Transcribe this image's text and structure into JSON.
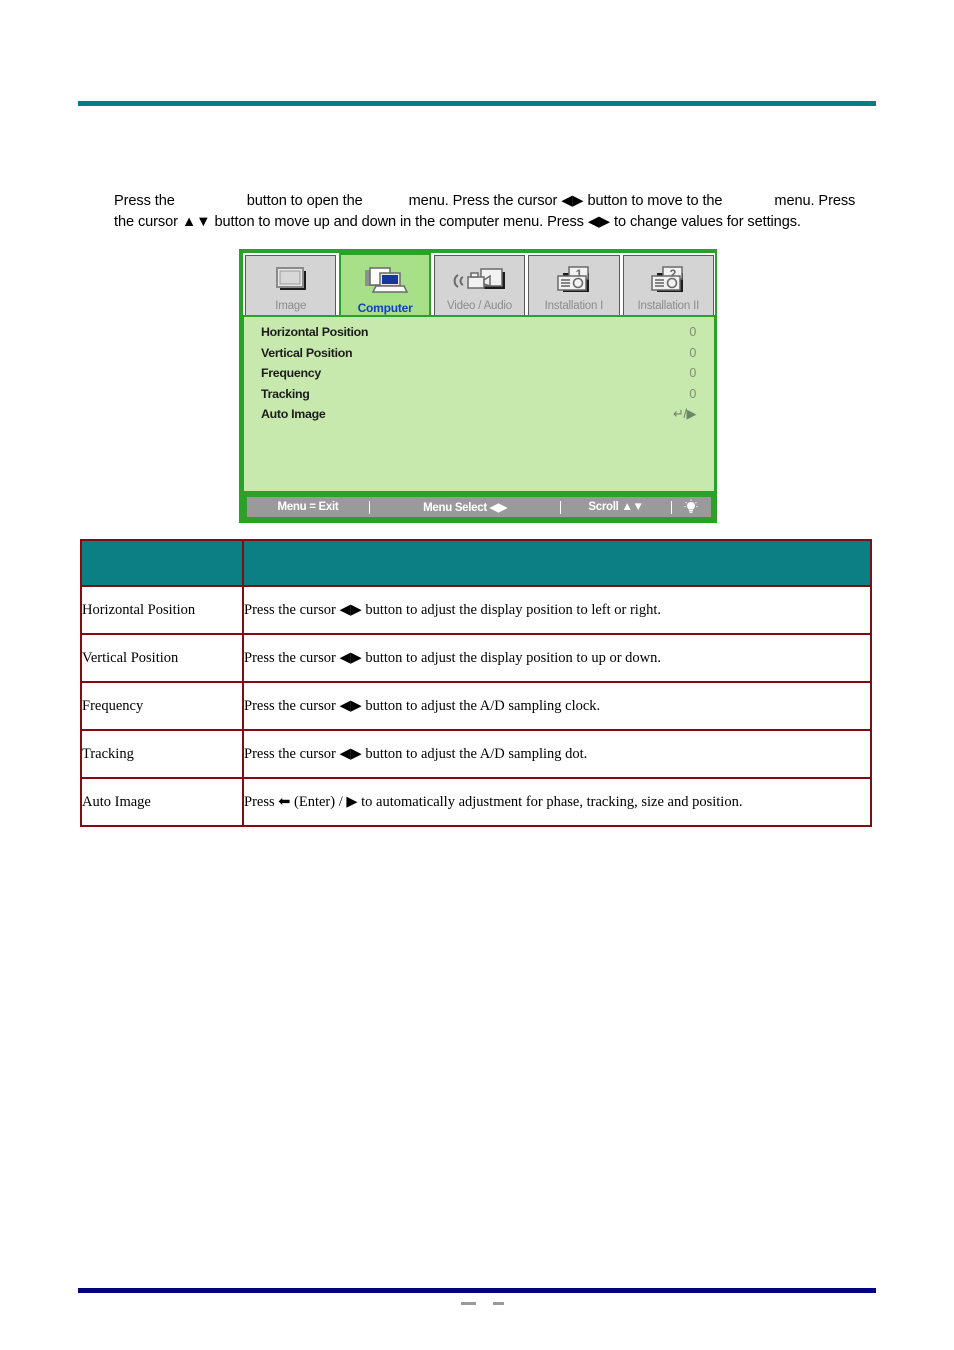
{
  "intro": {
    "seg1": "Press the",
    "seg2": "button to open the",
    "seg3": "menu. Press the cursor ◀▶ button to move to the",
    "seg4": "menu. Press the cursor ▲▼ button to move up and down in the computer menu. Press ◀▶ to change values for settings."
  },
  "osd": {
    "tabs": [
      {
        "label": "Image",
        "icon": "screen-icon",
        "active": false
      },
      {
        "label": "Computer",
        "icon": "laptop-icon",
        "active": true
      },
      {
        "label": "Video / Audio",
        "icon": "camcorder-icon",
        "active": false
      },
      {
        "label": "Installation I",
        "icon": "projector-one-icon",
        "active": false
      },
      {
        "label": "Installation II",
        "icon": "projector-two-icon",
        "active": false
      }
    ],
    "items": [
      {
        "label": "Horizontal Position",
        "value": "0"
      },
      {
        "label": "Vertical Position",
        "value": "0"
      },
      {
        "label": "Frequency",
        "value": "0"
      },
      {
        "label": "Tracking",
        "value": "0"
      },
      {
        "label": "Auto Image",
        "value": "↵/▶"
      }
    ],
    "footer": {
      "exit": "Menu = Exit",
      "select": "Menu Select ◀▶",
      "scroll": "Scroll ▲▼",
      "lamp": "lamp-icon"
    },
    "colors": {
      "border": "#2aa22a",
      "body_bg": "#c8e9ae",
      "active_tab_bg": "#a8e08a",
      "active_tab_text": "#1040c0",
      "tab_bg": "#d4d4d4",
      "tab_text": "#8c8c8c",
      "footer_bg": "#9a9a9a"
    }
  },
  "table": {
    "header": {
      "col_a": "",
      "col_b": ""
    },
    "rows": [
      {
        "item": "Horizontal Position",
        "desc": "Press the cursor ◀▶ button to adjust the display position to left or right."
      },
      {
        "item": "Vertical Position",
        "desc": "Press the cursor ◀▶ button to adjust the display position to up or down."
      },
      {
        "item": "Frequency",
        "desc": "Press the cursor ◀▶ button to adjust the A/D sampling clock."
      },
      {
        "item": "Tracking",
        "desc": "Press the cursor ◀▶ button to adjust the A/D sampling dot."
      },
      {
        "item": "Auto Image",
        "desc": "Press ⬅ (Enter) / ▶ to automatically adjustment for phase, tracking, size and position."
      }
    ],
    "colors": {
      "border": "#7c1010",
      "header_bg": "#0b7f84"
    }
  },
  "rules": {
    "top_color": "#007f7f",
    "bottom_color": "#000080"
  }
}
